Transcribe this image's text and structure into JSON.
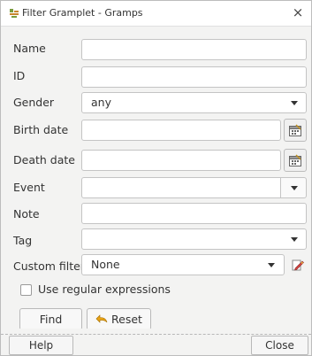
{
  "window": {
    "title": "Filter Gramplet - Gramps",
    "close_glyph": "×",
    "icon": "gramps-filter-icon"
  },
  "form": {
    "name_label": "Name",
    "name_value": "",
    "id_label": "ID",
    "id_value": "",
    "gender_label": "Gender",
    "gender_value": "any",
    "birth_label": "Birth date",
    "birth_value": "",
    "death_label": "Death date",
    "death_value": "",
    "event_label": "Event",
    "event_value": "",
    "note_label": "Note",
    "note_value": "",
    "tag_label": "Tag",
    "tag_value": "",
    "custom_filter_label": "Custom filter",
    "custom_filter_value": "None",
    "regex_label": "Use regular expressions",
    "regex_checked": false
  },
  "actions": {
    "find_label": "Find",
    "reset_label": "Reset"
  },
  "footer": {
    "help_label": "Help",
    "close_label": "Close"
  },
  "colors": {
    "panel_bg": "#f3f3f2",
    "border": "#c4c4c4",
    "reset_icon": "#e8a317",
    "edit_icon": "#d64541"
  }
}
